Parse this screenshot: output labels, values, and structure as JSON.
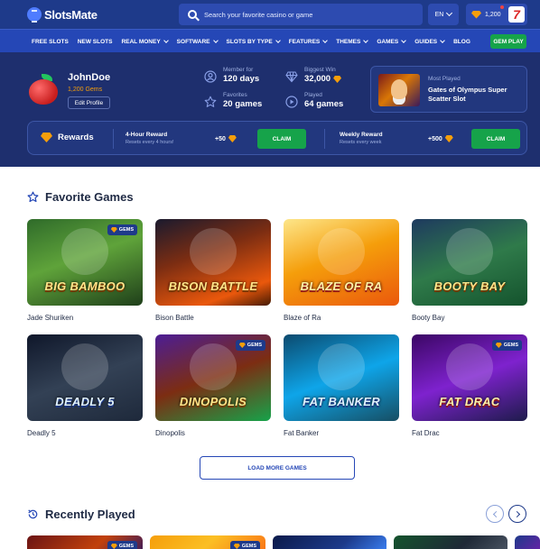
{
  "brand": {
    "name": "SlotsMate"
  },
  "header": {
    "search_placeholder": "Search your favorite casino or game",
    "language": "EN",
    "gems_balance": "1,200"
  },
  "nav": {
    "items": [
      {
        "label": "Free Slots",
        "dropdown": false
      },
      {
        "label": "New Slots",
        "dropdown": false
      },
      {
        "label": "Real Money",
        "dropdown": true
      },
      {
        "label": "Software",
        "dropdown": true
      },
      {
        "label": "Slots by Type",
        "dropdown": true
      },
      {
        "label": "Features",
        "dropdown": true
      },
      {
        "label": "Themes",
        "dropdown": true
      },
      {
        "label": "Games",
        "dropdown": true
      },
      {
        "label": "Guides",
        "dropdown": true
      },
      {
        "label": "Blog",
        "dropdown": false
      }
    ],
    "cta_label": "GEM PLAY"
  },
  "profile": {
    "username": "JohnDoe",
    "gems": "1,200 Gems",
    "edit_label": "Edit Profile",
    "stats": {
      "member_for": {
        "label": "Member for",
        "value": "120 days"
      },
      "biggest_win": {
        "label": "Biggest Win",
        "value": "32,000"
      },
      "favorites": {
        "label": "Favorites",
        "value": "20 games"
      },
      "played": {
        "label": "Played",
        "value": "64 games"
      }
    },
    "most_played": {
      "label": "Most Played",
      "title": "Gates of Olympus Super Scatter Slot"
    }
  },
  "rewards": {
    "title": "Rewards",
    "four_hour": {
      "name": "4-Hour Reward",
      "sub": "Resets every 4 hours!",
      "amount": "+50",
      "claim_label": "CLAIM"
    },
    "weekly": {
      "name": "Weekly Reward",
      "sub": "Resets every week",
      "amount": "+500",
      "claim_label": "CLAIM"
    }
  },
  "favorites": {
    "title": "Favorite Games",
    "badge_label": "GEMS",
    "games": [
      {
        "name": "Jade Shuriken",
        "logo": "BIG BAMBOO",
        "gems": true
      },
      {
        "name": "Bison Battle",
        "logo": "BISON BATTLE",
        "gems": false
      },
      {
        "name": "Blaze of Ra",
        "logo": "BLAZE OF RA",
        "gems": false
      },
      {
        "name": "Booty Bay",
        "logo": "BOOTY BAY",
        "gems": false
      },
      {
        "name": "Deadly 5",
        "logo": "DEADLY 5",
        "gems": false
      },
      {
        "name": "Dinopolis",
        "logo": "DINOPOLIS",
        "gems": true
      },
      {
        "name": "Fat Banker",
        "logo": "FAT BANKER",
        "gems": false
      },
      {
        "name": "Fat Drac",
        "logo": "FAT DRAC",
        "gems": true
      }
    ],
    "load_more_label": "LOAD MORE GAMES"
  },
  "recent": {
    "title": "Recently Played",
    "badge_label": "GEMS"
  },
  "colors": {
    "header": "#1e3a8a",
    "nav": "#2547b6",
    "panel": "#1e2f6e",
    "accent_green": "#16a34a",
    "gem_orange": "#f59e0b"
  }
}
